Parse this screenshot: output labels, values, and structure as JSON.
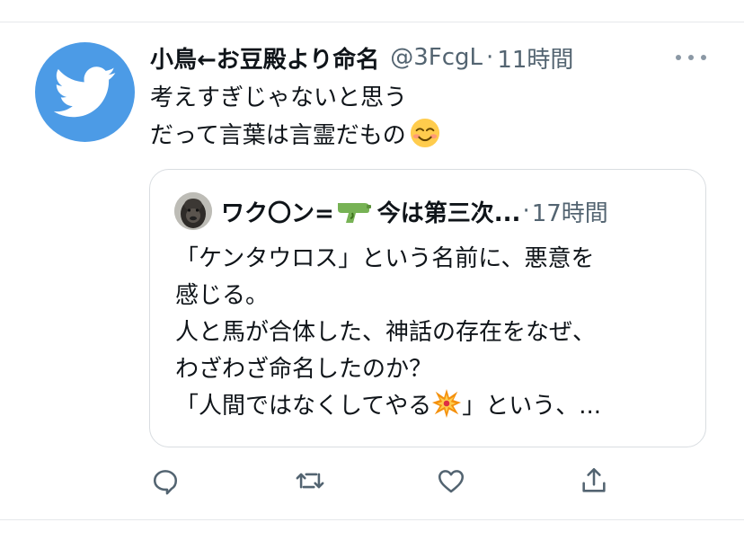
{
  "tweet": {
    "display_name": "小鳥←お豆殿より命名",
    "handle": "@3FcgL",
    "separator": "·",
    "time": "11時間",
    "text_lines": [
      "考えすぎじゃないと思う",
      "だって言葉は言霊だもの"
    ],
    "text_emoji": "smiling-face-icon",
    "avatar_icon": "twitter-bird-icon",
    "avatar_color": "#4c9be6"
  },
  "quote": {
    "name_part1": "ワク〇ン=",
    "name_emoji": "water-pistol-icon",
    "name_part2": "今は第三次...",
    "separator": "·",
    "time": "17時間",
    "text_lines": [
      "「ケンタウロス」という名前に、悪意を",
      "感じる。",
      "人と馬が合体した、神話の存在をなぜ、",
      "わざわざ命名したのか？"
    ],
    "last_line_before": "「人間ではなくしてやる",
    "last_line_emoji": "collision-icon",
    "last_line_after": "」という、..."
  },
  "actions": [
    "reply-icon",
    "retweet-icon",
    "like-icon",
    "share-icon"
  ],
  "colors": {
    "text": "#0f1419",
    "secondary": "#536471",
    "icon": "#536471",
    "border": "#d9dde1"
  }
}
